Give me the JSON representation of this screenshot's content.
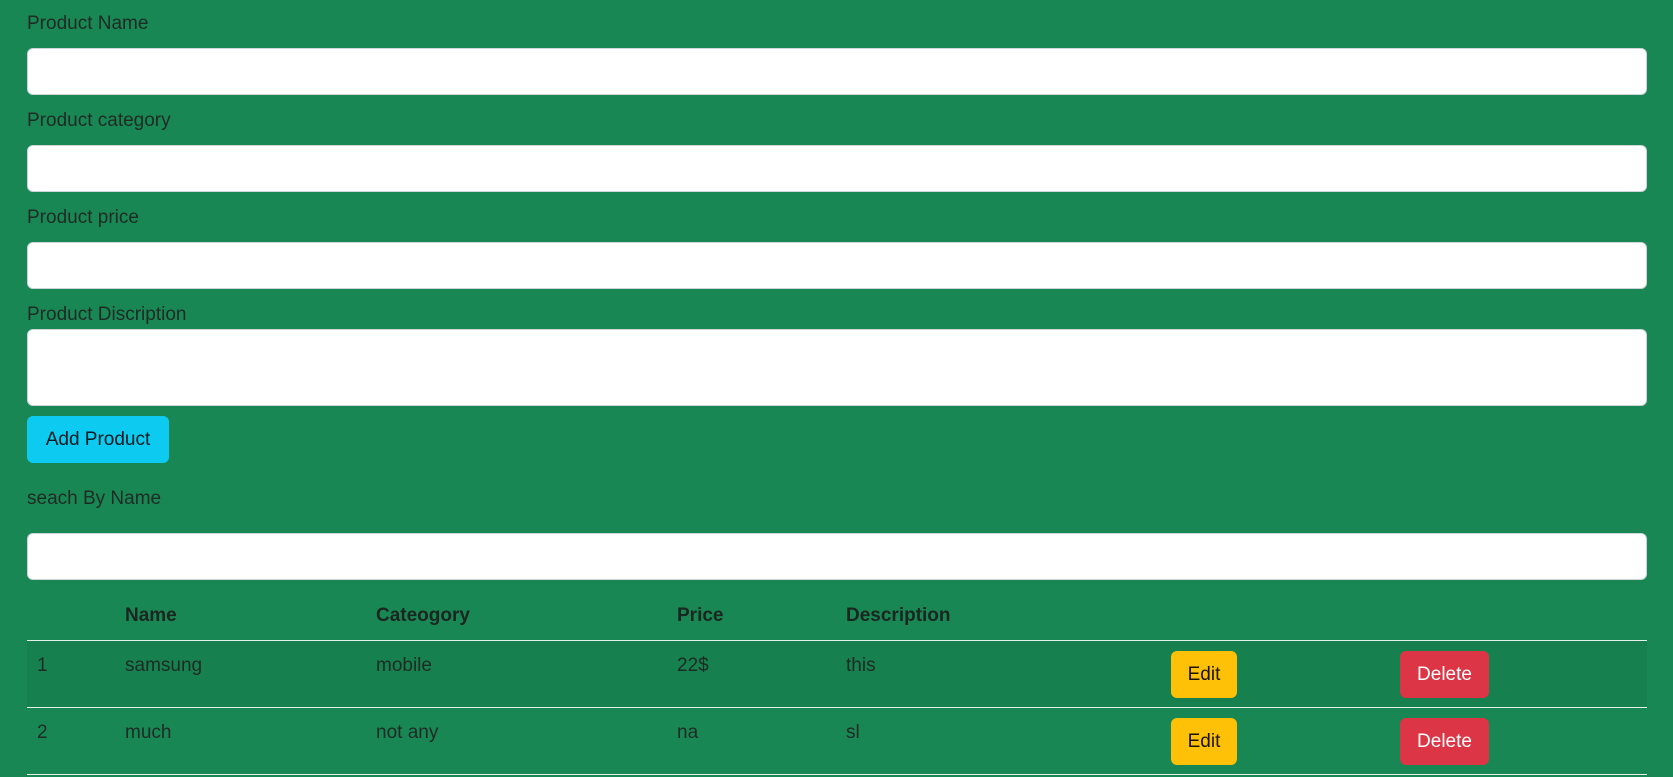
{
  "form": {
    "name_label": "Product Name",
    "name_value": "",
    "category_label": "Product category",
    "category_value": "",
    "price_label": "Product price",
    "price_value": "",
    "description_label": "Product Discription",
    "description_value": "",
    "add_button_label": "Add Product"
  },
  "search": {
    "label": "seach By Name",
    "value": ""
  },
  "table": {
    "headers": [
      "",
      "Name",
      "Cateogory",
      "Price",
      "Description",
      "",
      ""
    ],
    "rows": [
      {
        "index": "1",
        "name": "samsung",
        "category": "mobile",
        "price": "22$",
        "description": "this",
        "edit_label": "Edit",
        "delete_label": "Delete"
      },
      {
        "index": "2",
        "name": "much",
        "category": "not any",
        "price": "na",
        "description": "sl",
        "edit_label": "Edit",
        "delete_label": "Delete"
      }
    ]
  },
  "colors": {
    "background": "#198754",
    "info_button": "#0dcaf0",
    "warning_button": "#ffc107",
    "danger_button": "#dc3545"
  }
}
